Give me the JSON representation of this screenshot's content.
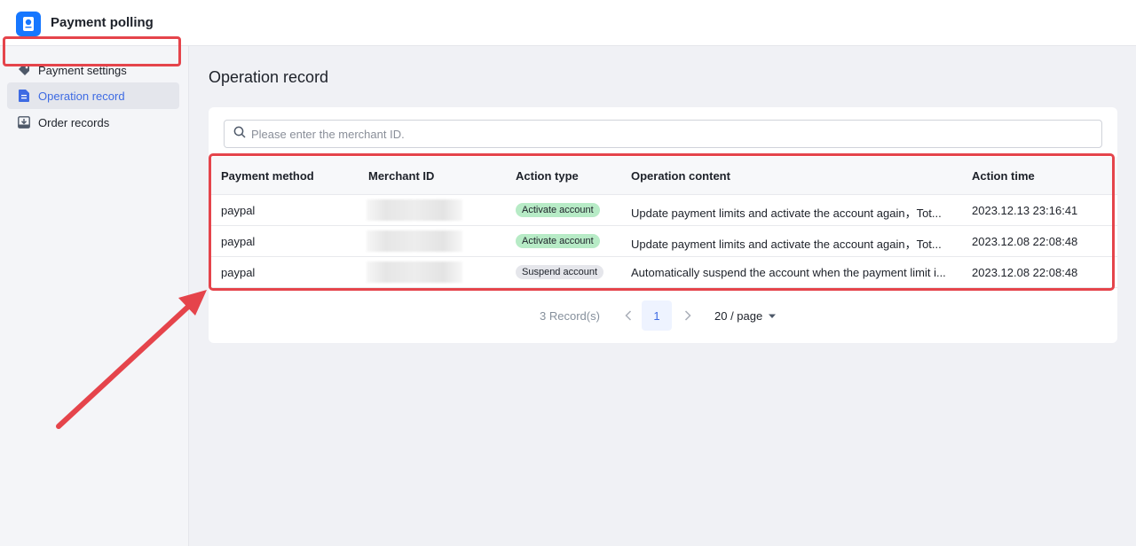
{
  "app": {
    "title": "Payment polling"
  },
  "sidebar": {
    "items": [
      {
        "label": "Payment settings",
        "icon": "tag-icon"
      },
      {
        "label": "Operation record",
        "icon": "document-icon",
        "active": true
      },
      {
        "label": "Order records",
        "icon": "download-tray-icon"
      }
    ]
  },
  "main": {
    "title": "Operation record",
    "search": {
      "placeholder": "Please enter the merchant ID.",
      "value": ""
    },
    "table": {
      "headers": [
        "Payment method",
        "Merchant ID",
        "Action type",
        "Operation content",
        "Action time"
      ],
      "rows": [
        {
          "method": "paypal",
          "merchant_id": "",
          "action": "Activate account",
          "content": "Update payment limits and activate the account again，Tot...",
          "time": "2023.12.13 23:16:41"
        },
        {
          "method": "paypal",
          "merchant_id": "",
          "action": "Activate account",
          "content": "Update payment limits and activate the account again，Tot...",
          "time": "2023.12.08 22:08:48"
        },
        {
          "method": "paypal",
          "merchant_id": "",
          "action": "Suspend account",
          "content": "Automatically suspend the account when the payment limit i...",
          "time": "2023.12.08 22:08:48"
        }
      ]
    },
    "pagination": {
      "total": "3 Record(s)",
      "current": "1",
      "page_size": "20 / page"
    }
  },
  "colors": {
    "accent": "#3e6be3",
    "highlight": "#e5444b",
    "activate_badge": "#b7ebc6",
    "suspend_badge": "#e5e6eb"
  }
}
